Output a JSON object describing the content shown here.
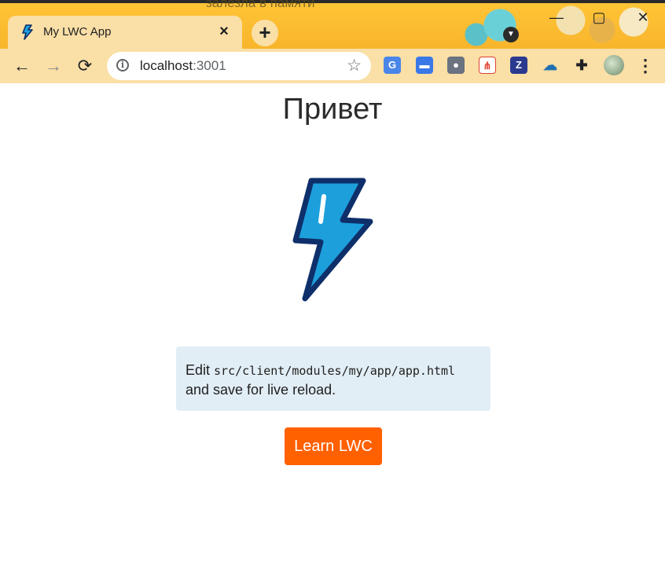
{
  "browser": {
    "background_text": "залезла в памяти",
    "tab_title": "My LWC App",
    "tab_close_glyph": "×",
    "new_tab_glyph": "+",
    "url_host": "localhost",
    "url_port": ":3001",
    "nav": {
      "back_glyph": "←",
      "forward_glyph": "→",
      "reload_glyph": "⟳"
    },
    "extensions": [
      "google-translate",
      "chat",
      "lightbulb",
      "sitemap",
      "z-extension",
      "cloud-sync",
      "extensions-puzzle",
      "profile-avatar"
    ],
    "colors": {
      "tabbar": "#f8b52c",
      "toolbar": "#fadfa6"
    }
  },
  "page": {
    "title": "Привет",
    "edit_prefix": "Edit ",
    "edit_path": "src/client/modules/my/app/app.html",
    "edit_suffix": "and save for live reload.",
    "button_label": "Learn LWC",
    "colors": {
      "button": "#ff6000",
      "code_box": "#e2eef5",
      "logo_fill": "#1d9fdc",
      "logo_stroke": "#0e2f6a"
    }
  }
}
